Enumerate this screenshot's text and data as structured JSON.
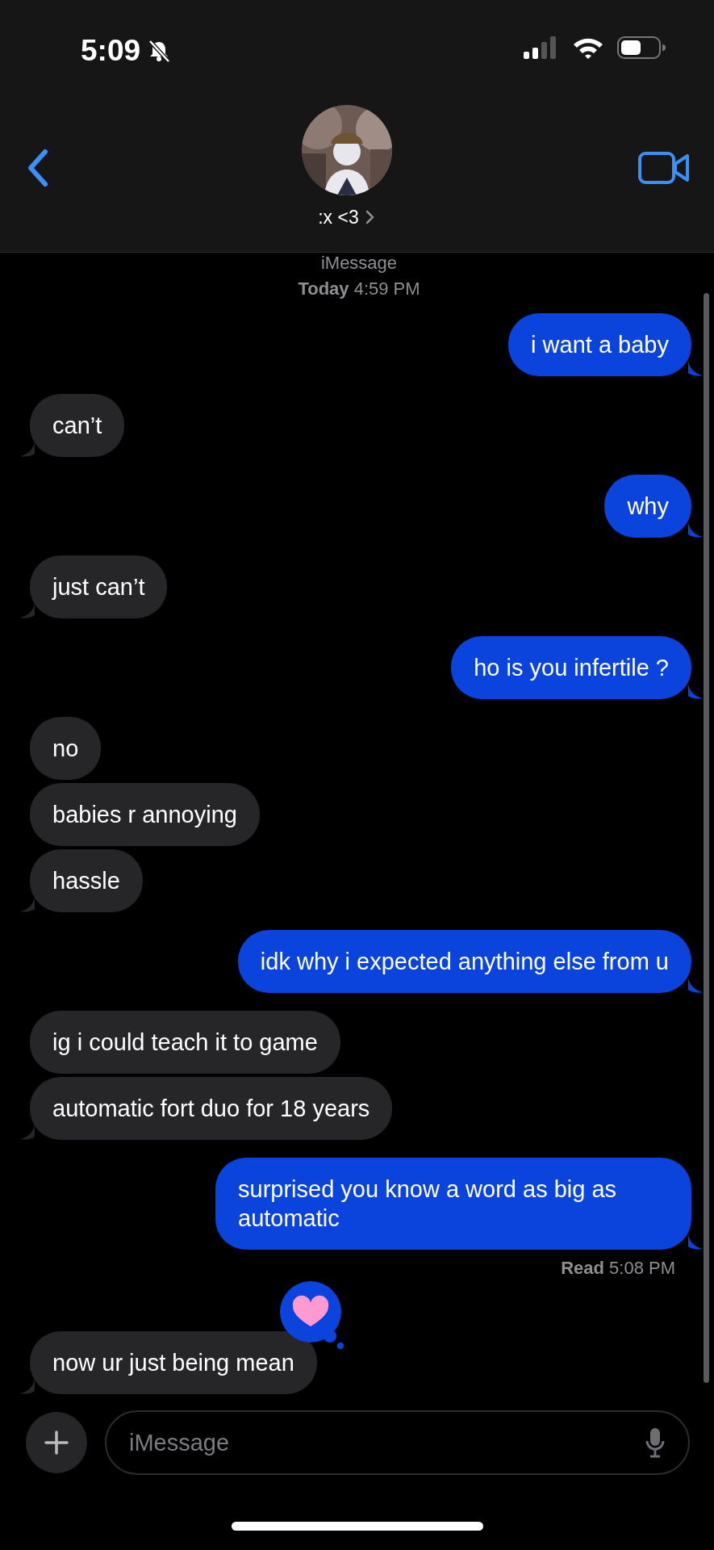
{
  "status_bar": {
    "time": "5:09",
    "silent": true
  },
  "header": {
    "contact_name": ":x <3"
  },
  "service_label": "iMessage",
  "timestamp": {
    "day": "Today",
    "time": "4:59 PM"
  },
  "messages": [
    {
      "kind": "sent",
      "text": "i want a baby",
      "tail": true
    },
    {
      "kind": "received",
      "text": "can’t",
      "tail": true
    },
    {
      "kind": "sent",
      "text": "why",
      "tail": true
    },
    {
      "kind": "received",
      "text": "just can’t",
      "tail": true
    },
    {
      "kind": "sent",
      "text": "ho is you infertile ?",
      "tail": true
    },
    {
      "kind": "received",
      "text": "no",
      "tail": false
    },
    {
      "kind": "received",
      "text": "babies r annoying",
      "tail": false
    },
    {
      "kind": "received",
      "text": "hassle",
      "tail": true
    },
    {
      "kind": "sent",
      "text": "idk why i expected anything else from u",
      "tail": true
    },
    {
      "kind": "received",
      "text": "ig i could teach it to game",
      "tail": false
    },
    {
      "kind": "received",
      "text": "automatic fort duo for 18 years",
      "tail": true
    },
    {
      "kind": "sent",
      "text": "surprised you know a word as big as automatic",
      "tail": true,
      "read_receipt": {
        "label": "Read",
        "time": "5:08 PM"
      }
    },
    {
      "kind": "received",
      "text": "now ur just being mean",
      "tail": true,
      "reaction": {
        "kind": "heart"
      }
    }
  ],
  "composer": {
    "placeholder": "iMessage"
  }
}
